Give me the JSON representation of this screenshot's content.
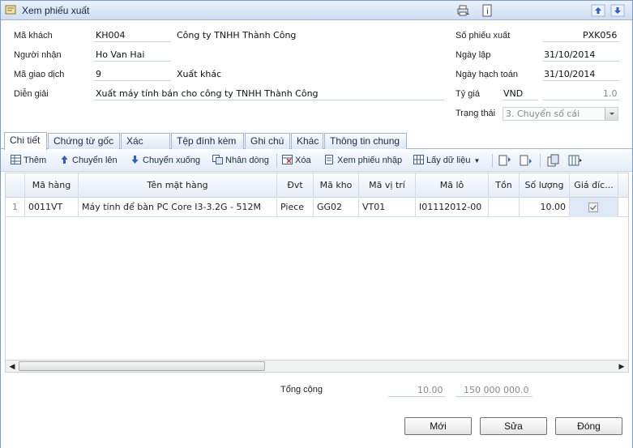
{
  "window": {
    "title": "Xem phiếu xuất"
  },
  "form": {
    "customer_code_label": "Mã khách",
    "customer_code": "KH004",
    "customer_name": "Công ty TNHH Thành Công",
    "receiver_label": "Người nhận",
    "receiver": "Ho Van Hai",
    "transaction_code_label": "Mã giao dịch",
    "transaction_code": "9",
    "transaction_name": "Xuất khác",
    "description_label": "Diễn giải",
    "description": "Xuất máy tính bán cho công ty TNHH Thành Công",
    "voucher_no_label": "Số phiếu xuất",
    "voucher_no": "PXK056",
    "date_label": "Ngày lập",
    "date": "31/10/2014",
    "posting_date_label": "Ngày hạch toán",
    "posting_date": "31/10/2014",
    "rate_label": "Tỷ giá",
    "currency": "VND",
    "rate": "1.0",
    "status_label": "Trạng thái",
    "status": "3. Chuyển sổ cái"
  },
  "tabs": [
    {
      "label": "Chi tiết"
    },
    {
      "label": "Chứng từ gốc"
    },
    {
      "label": "Xác thực"
    },
    {
      "label": "Tệp đính kèm"
    },
    {
      "label": "Ghi chú"
    },
    {
      "label": "Khác"
    },
    {
      "label": "Thông tin chung"
    }
  ],
  "toolbar": {
    "add": "Thêm",
    "move_up": "Chuyển lên",
    "move_down": "Chuyển xuống",
    "duplicate": "Nhân dòng",
    "delete": "Xóa",
    "view_receipt": "Xem phiếu nhập",
    "get_data": "Lấy dữ liệu"
  },
  "grid": {
    "columns": [
      "Mã hàng",
      "Tên mặt hàng",
      "Đvt",
      "Mã kho",
      "Mã vị trí",
      "Mã lô",
      "Tồn",
      "Số lượng",
      "Giá đíc..."
    ],
    "rows": [
      {
        "no": "1",
        "item_code": "0011VT",
        "item_name": "Máy tính để bàn PC Core I3-3.2G - 512M",
        "unit": "Piece",
        "warehouse": "GG02",
        "location": "VT01",
        "lot": "I01112012-00",
        "stock": "",
        "quantity": "10.00",
        "specific_price": true
      }
    ]
  },
  "footer": {
    "total_label": "Tổng cộng",
    "total_quantity": "10.00",
    "total_amount": "150 000 000.0"
  },
  "buttons": {
    "new": "Mới",
    "edit": "Sửa",
    "close": "Đóng"
  },
  "colors": {
    "accent": "#1b2b45",
    "border": "#9db5d8",
    "title_bg": "#cfdef2"
  }
}
